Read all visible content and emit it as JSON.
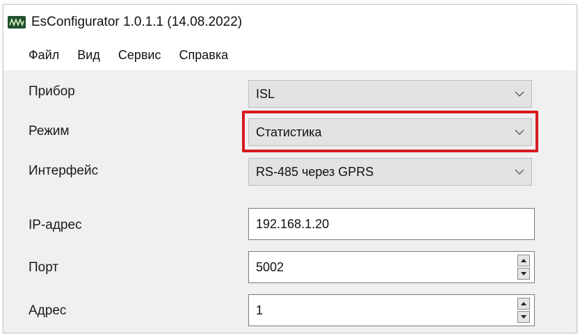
{
  "window": {
    "title": "EsConfigurator 1.0.1.1 (14.08.2022)",
    "icon": "waveform-app-icon"
  },
  "menu": {
    "items": [
      "Файл",
      "Вид",
      "Сервис",
      "Справка"
    ]
  },
  "form": {
    "device": {
      "label": "Прибор",
      "value": "ISL"
    },
    "mode": {
      "label": "Режим",
      "value": "Статистика",
      "highlight_color": "#d71920"
    },
    "interface": {
      "label": "Интерфейс",
      "value": "RS-485 через GPRS"
    },
    "ip": {
      "label": "IP-адрес",
      "value": "192.168.1.20"
    },
    "port": {
      "label": "Порт",
      "value": "5002"
    },
    "address": {
      "label": "Адрес",
      "value": "1"
    }
  }
}
